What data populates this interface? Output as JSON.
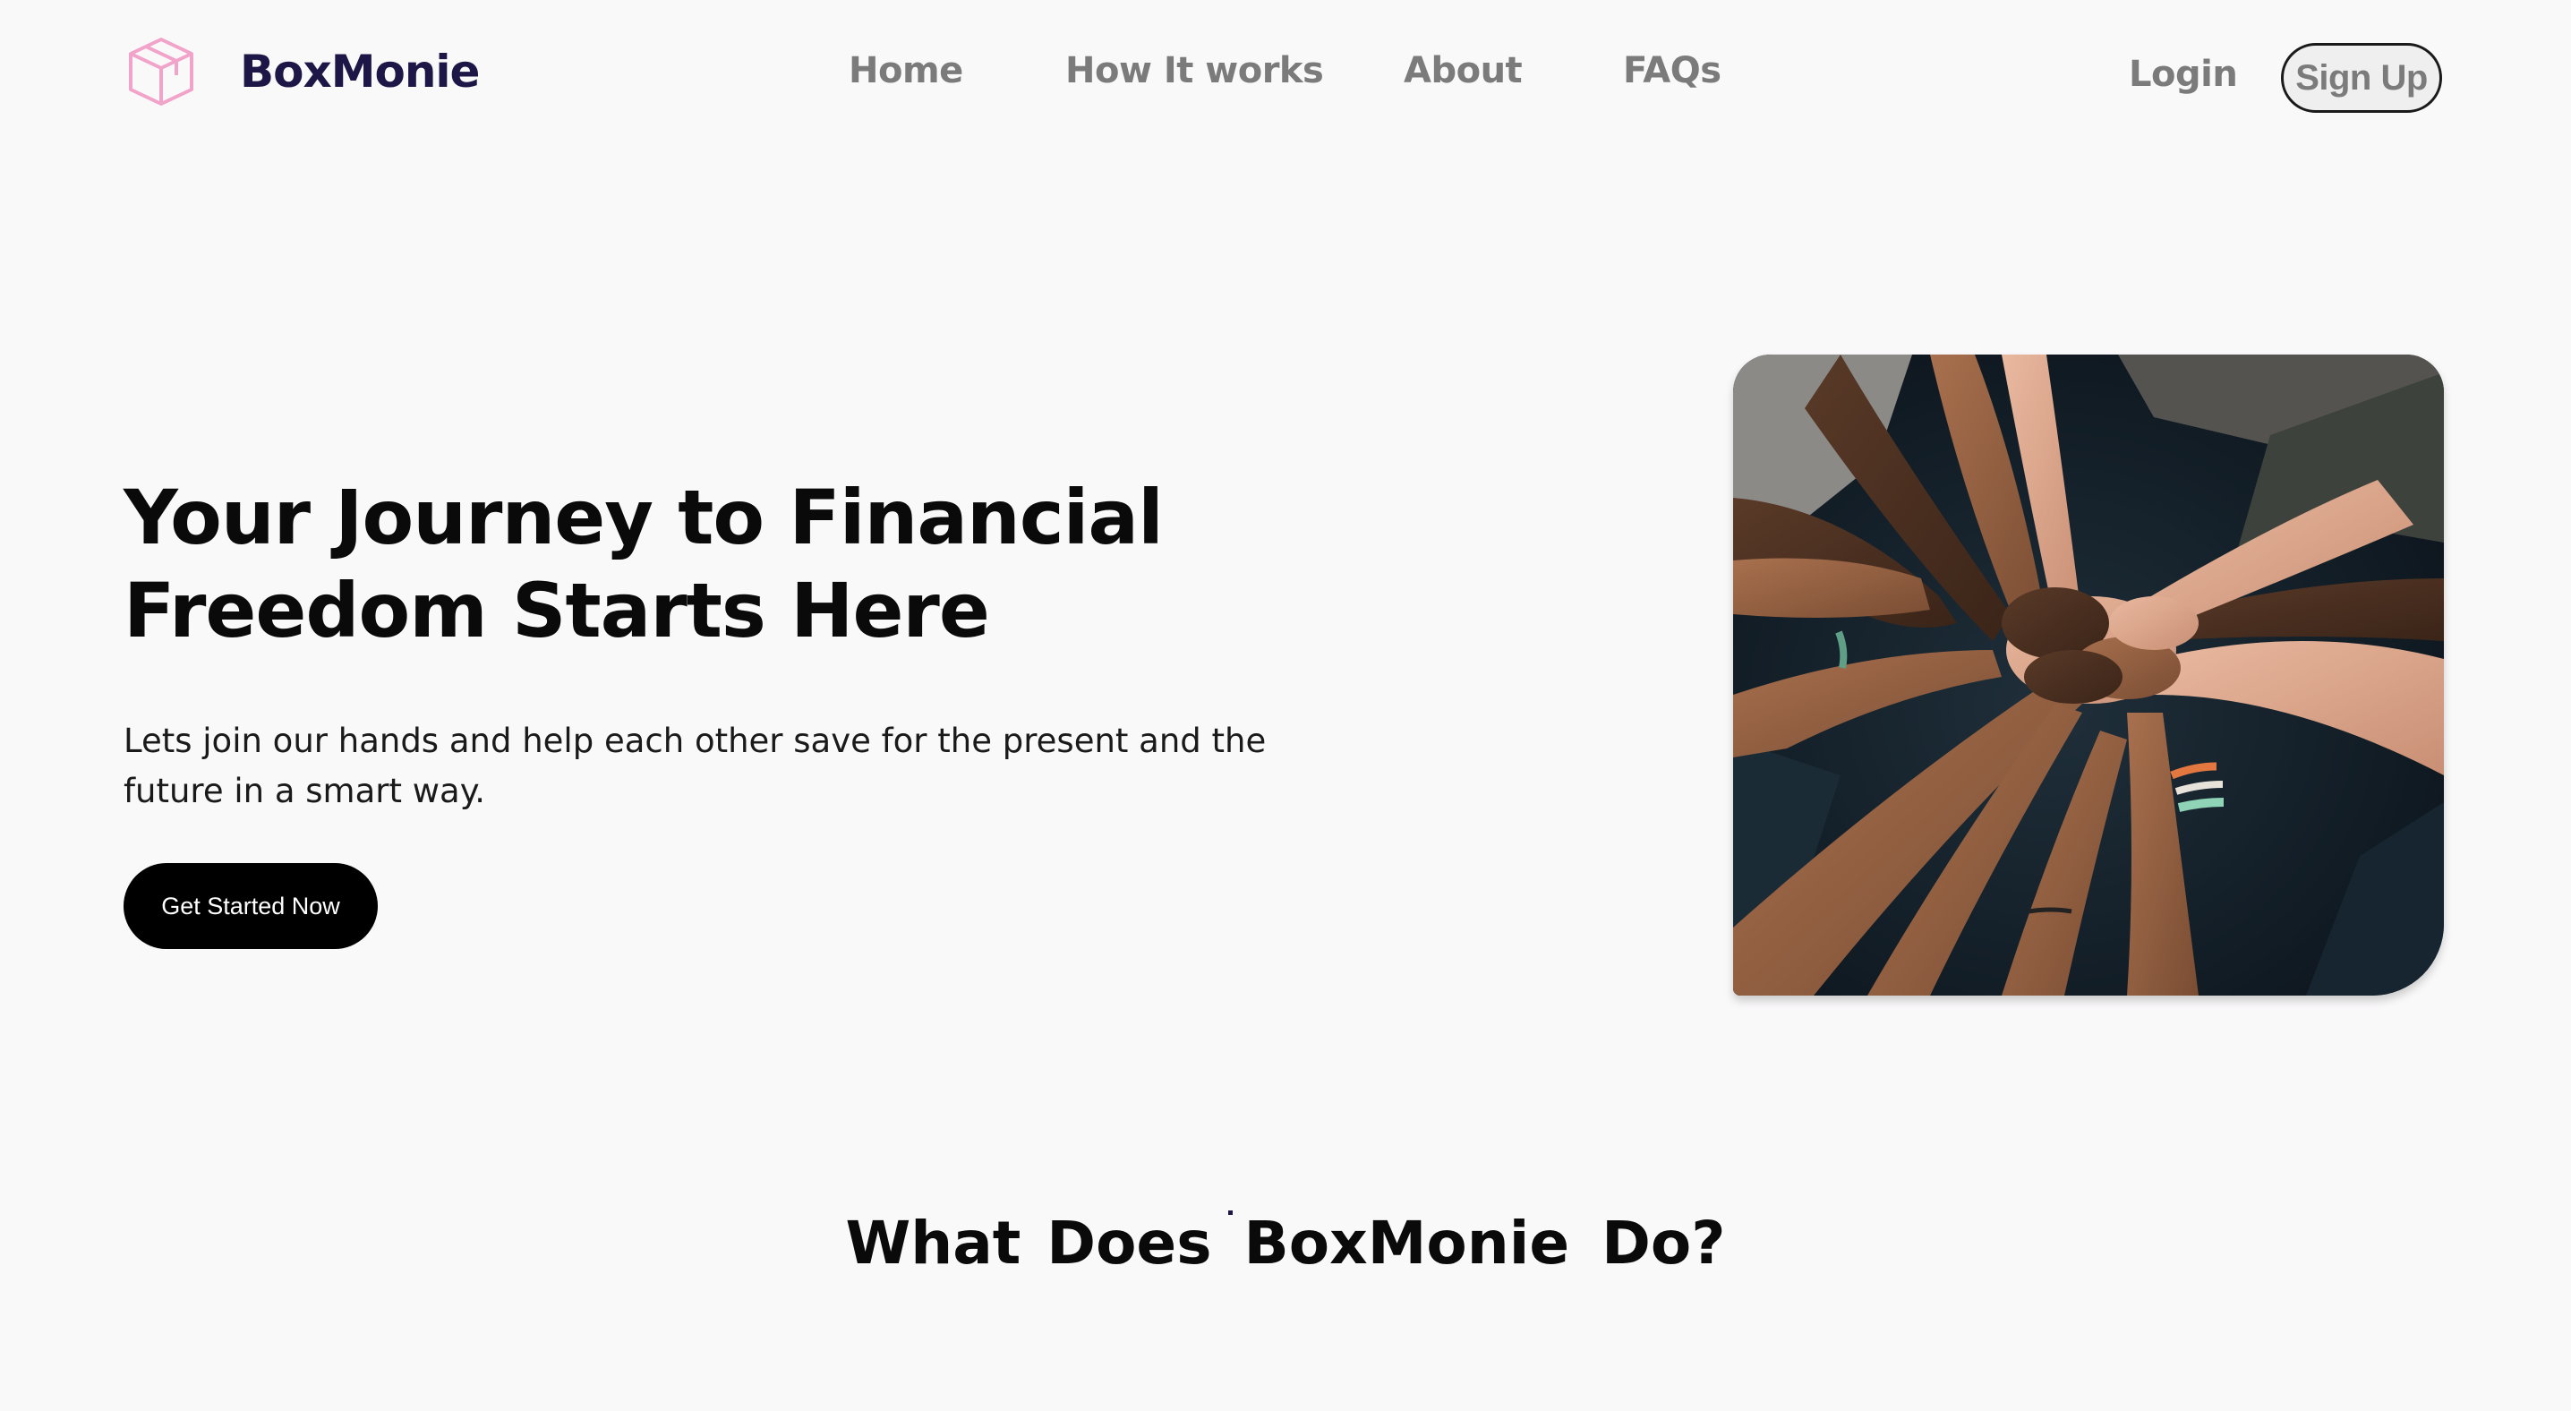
{
  "brand": {
    "name": "BoxMonie",
    "logo_icon": "cube-icon",
    "logo_color": "#f2a3c9",
    "text_color": "#1c1746"
  },
  "nav": {
    "items": [
      {
        "label": "Home"
      },
      {
        "label": "How It works"
      },
      {
        "label": "About"
      },
      {
        "label": "FAQs"
      }
    ],
    "login_label": "Login",
    "signup_label": "Sign Up"
  },
  "hero": {
    "title_line1": "Your Journey to Financial",
    "title_line2": "Freedom Starts Here",
    "subtitle": "Lets join our hands and help each other save for the present and the future in a smart way.",
    "cta_label": "Get Started Now",
    "image_subject": "hands-together-photo"
  },
  "section": {
    "title_part1": "What Does",
    "title_brand": "BoxMonie",
    "title_part2": "Do?"
  },
  "colors": {
    "background": "#faf9fa",
    "nav_text": "#7b7b7b",
    "cta_bg": "#000000",
    "cta_text": "#ffffff"
  }
}
